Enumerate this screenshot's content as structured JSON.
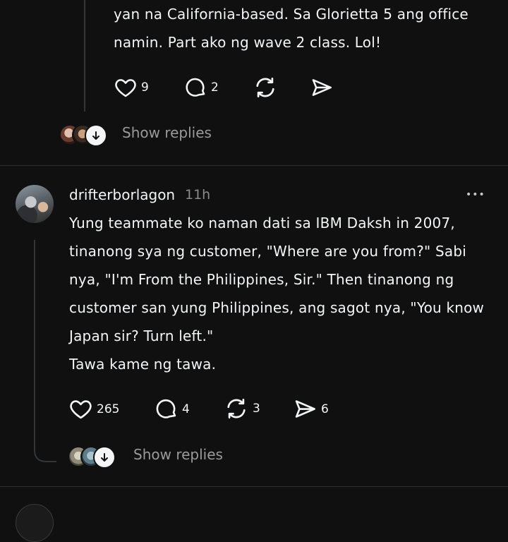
{
  "post1": {
    "lines": [
      "yan na California-based. Sa Glorietta 5 ang office",
      "namin. Part ako ng wave 2 class. Lol!"
    ],
    "likes": "9",
    "comments": "2",
    "reposts": "",
    "shares": "",
    "show_replies": "Show replies"
  },
  "post2": {
    "username": "drifterborlagon",
    "time": "11h",
    "more": "•••",
    "lines": [
      "Yung teammate ko naman dati sa IBM Daksh in 2007,",
      "tinanong sya ng customer, \"Where are you from?\" Sabi",
      "nya, \"I'm From the Philippines, Sir.\" Then tinanong ng",
      "customer san yung Philippines, ang sagot nya, \"You know",
      "Japan sir? Turn left.\"",
      "Tawa kame ng tawa."
    ],
    "likes": "265",
    "comments": "4",
    "reposts": "3",
    "shares": "6",
    "show_replies": "Show replies"
  },
  "icons": {
    "like": "heart-icon",
    "comment": "comment-icon",
    "repost": "repost-icon",
    "share": "share-icon",
    "down": "arrow-down-icon"
  }
}
